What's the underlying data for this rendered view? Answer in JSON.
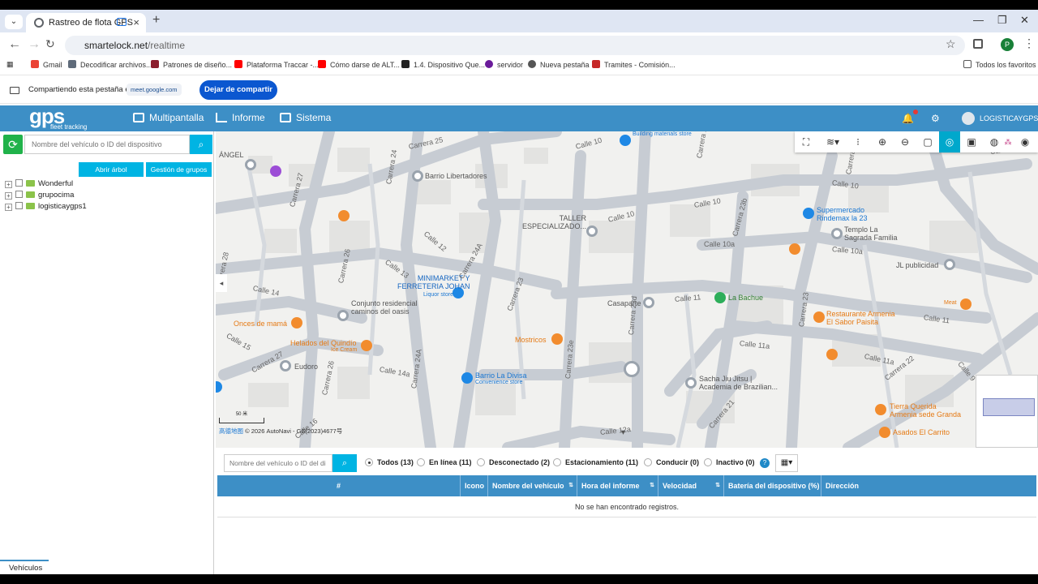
{
  "browser": {
    "tab_title": "Rastreo de flota GPS",
    "url_domain": "smartelock.net",
    "url_path": "/realtime",
    "profile_initial": "P",
    "bookmarks": [
      "Gmail",
      "Decodificar archivos...",
      "Patrones de diseño...",
      "Plataforma Traccar -...",
      "Cómo darse de ALT...",
      "1.4. Dispositivo Que...",
      "servidor",
      "Nueva pestaña",
      "Tramites - Comisión..."
    ],
    "all_bookmarks": "Todos los favoritos"
  },
  "share_bar": {
    "text": "Compartiendo esta pestaña en",
    "target": "meet.google.com",
    "stop_label": "Dejar de compartir"
  },
  "header": {
    "logo_main": "gps",
    "logo_sub": "fleet tracking",
    "menu": [
      "Multipantalla",
      "Informe",
      "Sistema"
    ],
    "notif_count": "0",
    "username": "LOGISTICAYGPS"
  },
  "left_panel": {
    "search_placeholder": "Nombre del vehículo o ID del dispositivo",
    "open_tree_label": "Abrir árbol",
    "group_mgmt_label": "Gestión de grupos",
    "groups": [
      "Wonderful",
      "grupocima",
      "logisticaygps1"
    ],
    "bottom_tab": "Vehículos"
  },
  "map": {
    "labels": {
      "building": "Building materials store",
      "barrio_lib": "Barrio Libertadores",
      "taller": "TALLER\nESPECIALIZADO...",
      "minimarket": "MINIMARKET Y\nFERRETERIA JOHAN",
      "liquor": "Liquor store",
      "conjunto": "Conjunto residencial\ncaminos del oasis",
      "onces": "Onces de mamá",
      "helados": "Helados del Quindío",
      "icecream": "Ice Cream",
      "eudoro": "Eudoro",
      "mostricos": "Mostricos",
      "casaparte": "Casaparte",
      "divisa": "Barrio La Divisa",
      "conv": "Convenience store",
      "sacha": "Sacha Jiu Jitsu |\nAcademia de Brazilian...",
      "supermercado": "Supermercado\nRindemax la 23",
      "templo": "Templo La\nSagrada Familia",
      "bachue": "La Bachue",
      "jl": "JL publicidad",
      "meat": "Meat",
      "restaurante": "Restaurante Armenia\nEl Sabor Paisita",
      "tierra": "Tierra Querida\nArmenia sede Granda",
      "asados": "Asados El Carrito",
      "angel": "ÁNGEL"
    },
    "roads": [
      "Carrera 25",
      "Calle 10",
      "Carrera 24",
      "Calle 12",
      "Carrera 26",
      "Calle 13",
      "Carrera 27",
      "Calle 14",
      "Calle 15",
      "Carrera 28",
      "Carrera 24A",
      "Carrera 23",
      "Calle 11",
      "Calle 10a",
      "Calle 11a",
      "Calle 14a",
      "Carrera 23b",
      "Carrera 23d",
      "Carrera 23e",
      "Calle 12a",
      "Carrera 22",
      "Calle 9",
      "Carrera 23c",
      "Calle 16",
      "Carrera 21"
    ],
    "scale_label": "50 米",
    "credit": "© 2026 AutoNavi - GS(2023)4677号",
    "provider": "高德地图"
  },
  "bottom_panel": {
    "search_placeholder": "Nombre del vehículo o ID del di",
    "filters": [
      "Todos (13)",
      "En línea (11)",
      "Desconectado (2)",
      "Estacionamiento (11)",
      "Conducir (0)",
      "Inactivo (0)"
    ],
    "help": "?",
    "columns": [
      "#",
      "Icono",
      "Nombre del vehículo",
      "Hora del informe",
      "Velocidad",
      "Batería del dispositivo (%)",
      "Dirección"
    ],
    "empty_message": "No se han encontrado registros."
  },
  "colors": {
    "header_blue": "#3d8fc6",
    "accent_cyan": "#00b4e3",
    "green": "#20b24a"
  }
}
